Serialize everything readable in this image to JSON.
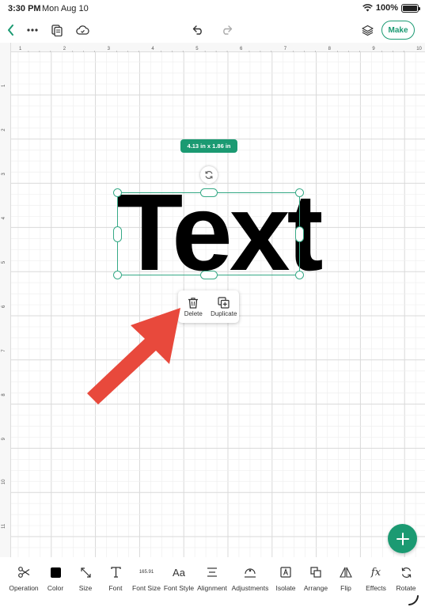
{
  "status": {
    "time": "3:30 PM",
    "date": "Mon Aug 10",
    "battery": "100%"
  },
  "toolbar": {
    "make_label": "Make"
  },
  "rulers": {
    "top_ticks": [
      "1",
      "2",
      "3",
      "4",
      "5",
      "6",
      "7",
      "8",
      "9",
      "10"
    ],
    "left_ticks": [
      "1",
      "2",
      "3",
      "4",
      "5",
      "6",
      "7",
      "8",
      "9",
      "10",
      "11"
    ]
  },
  "canvas": {
    "size_label": "4.13 in x 1.86 in",
    "text_object": "Text"
  },
  "context_menu": {
    "delete_label": "Delete",
    "duplicate_label": "Duplicate"
  },
  "colors": {
    "accent": "#1b9a72",
    "arrow": "#e8493c"
  },
  "bottom_bar": {
    "operation": "Operation",
    "color": "Color",
    "size": "Size",
    "font": "Font",
    "font_size_value": "165.91",
    "font_size": "Font Size",
    "font_style": "Font Style",
    "font_style_icon": "Aa",
    "alignment": "Alignment",
    "adjustments": "Adjustments",
    "isolate": "Isolate",
    "arrange": "Arrange",
    "flip": "Flip",
    "effects": "Effects",
    "effects_icon": "fx",
    "rotate": "Rotate"
  }
}
